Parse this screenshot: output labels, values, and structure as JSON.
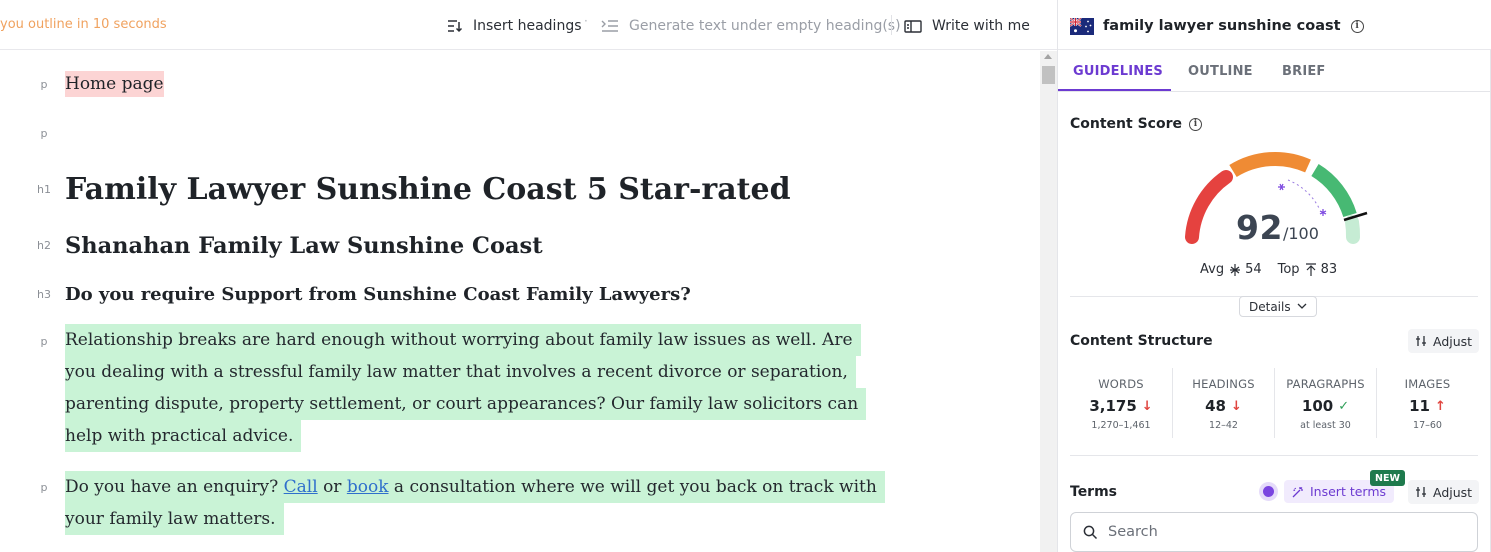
{
  "toolbar": {
    "notice": "you outline in 10 seconds",
    "insert_headings": "Insert headings",
    "generate_text": "Generate text under empty heading(s)",
    "write_with_me": "Write with me",
    "dot": "·"
  },
  "editor": {
    "blocks": [
      {
        "tag": "p",
        "text": "Home page"
      },
      {
        "tag": "p",
        "text": ""
      },
      {
        "tag": "h1",
        "text": "Family Lawyer Sunshine Coast 5 Star-rated"
      },
      {
        "tag": "h2",
        "text": "Shanahan Family Law Sunshine Coast"
      },
      {
        "tag": "h3",
        "text": "Do you require Support from Sunshine Coast Family Lawyers?"
      },
      {
        "tag": "p",
        "lines": [
          "Relationship breaks are hard enough without worrying about family law issues as well. Are",
          "you dealing with a stressful family law matter that involves a recent divorce or separation,",
          "parenting dispute, property settlement, or court appearances? Our family law solicitors can",
          "help with practical advice."
        ]
      },
      {
        "tag": "p",
        "pre_call": "Do you have an enquiry? ",
        "call": "Call",
        "or": " or ",
        "book": "book",
        "post_book": " a consultation where we will get you back on track with",
        "line2": "your family law matters. "
      }
    ]
  },
  "panel": {
    "keyword": "family lawyer sunshine coast",
    "flag_icon": "australia-flag-icon",
    "info_symbol": "i",
    "tabs": [
      "GUIDELINES",
      "OUTLINE",
      "BRIEF"
    ],
    "active_tab": "GUIDELINES",
    "content_score": {
      "title": "Content Score",
      "score": "92",
      "max": "/100",
      "avg_label": "Avg",
      "avg": "54",
      "top_label": "Top",
      "top": "83",
      "details": "Details"
    },
    "content_structure": {
      "title": "Content Structure",
      "adjust": "Adjust",
      "stats": [
        {
          "label": "WORDS",
          "value": "3,175",
          "arrow": "↓",
          "status": "down",
          "range": "1,270–1,461"
        },
        {
          "label": "HEADINGS",
          "value": "48",
          "arrow": "↓",
          "status": "down",
          "range": "12–42"
        },
        {
          "label": "PARAGRAPHS",
          "value": "100",
          "arrow": "✓",
          "status": "ok",
          "range": "at least 30"
        },
        {
          "label": "IMAGES",
          "value": "11",
          "arrow": "↑",
          "status": "up",
          "range": "17–60"
        }
      ]
    },
    "terms": {
      "title": "Terms",
      "insert_terms": "Insert terms",
      "new_badge": "NEW",
      "adjust": "Adjust",
      "search_placeholder": "Search"
    }
  },
  "colors": {
    "accent": "#6c3ad1",
    "highlight_green": "#c9f3d6",
    "highlight_red": "#fcd4d4",
    "gauge_red": "#e5423f",
    "gauge_orange": "#ef8b34",
    "gauge_green": "#47b973",
    "link": "#2f6fcc"
  }
}
